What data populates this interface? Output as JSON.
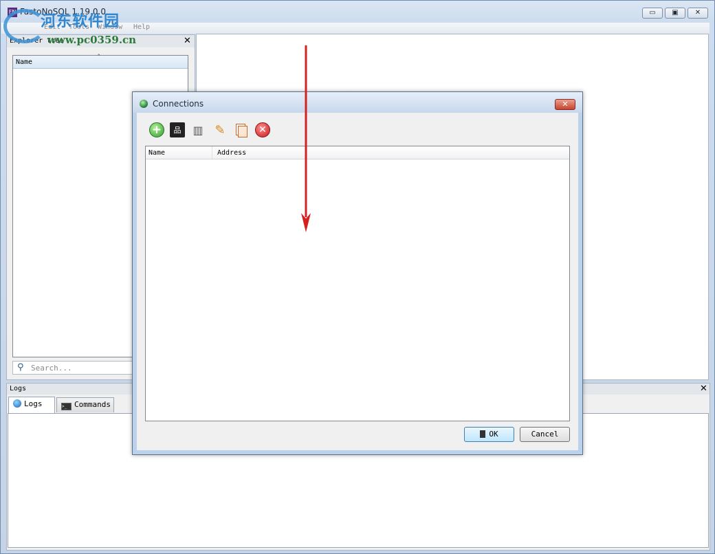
{
  "window": {
    "app_icon_text": "FN",
    "title": "FastoNoSQL 1.19.0.0",
    "controls": {
      "minimize": "▭",
      "maximize": "▣",
      "close": "✕"
    }
  },
  "menu": [
    "Edit",
    "Tools",
    "Window",
    "Help"
  ],
  "watermark": {
    "chinese": "河东软件园",
    "url": "www.pc0359.cn"
  },
  "explorer": {
    "title": "Explorer tree",
    "close": "✕",
    "column_name": "Name",
    "sort_indicator": "^",
    "search_placeholder": "Search..."
  },
  "logs": {
    "title": "Logs",
    "close": "✕",
    "tabs": [
      {
        "label": "Logs",
        "icon": "info-icon",
        "active": true
      },
      {
        "label": "Commands",
        "icon": "terminal-icon",
        "active": false
      }
    ]
  },
  "dialog": {
    "title": "Connections",
    "close": "✕",
    "toolbar": [
      {
        "name": "add-connection",
        "icon": "add-icon",
        "glyph": "+"
      },
      {
        "name": "discover-connections",
        "icon": "network-icon",
        "glyph": "品"
      },
      {
        "name": "add-cluster",
        "icon": "cluster-icon",
        "glyph": "▥"
      },
      {
        "name": "edit-connection",
        "icon": "pencil-icon",
        "glyph": "✎"
      },
      {
        "name": "clone-connection",
        "icon": "copy-icon",
        "glyph": ""
      },
      {
        "name": "remove-connection",
        "icon": "remove-icon",
        "glyph": "✕"
      }
    ],
    "columns": [
      "Name",
      "Address"
    ],
    "rows": [],
    "ok_label": "OK",
    "cancel_label": "Cancel"
  },
  "colors": {
    "annotation_arrow": "#d42020",
    "window_frame": "#c9d6e6",
    "dialog_frame": "#bcd2ea"
  }
}
